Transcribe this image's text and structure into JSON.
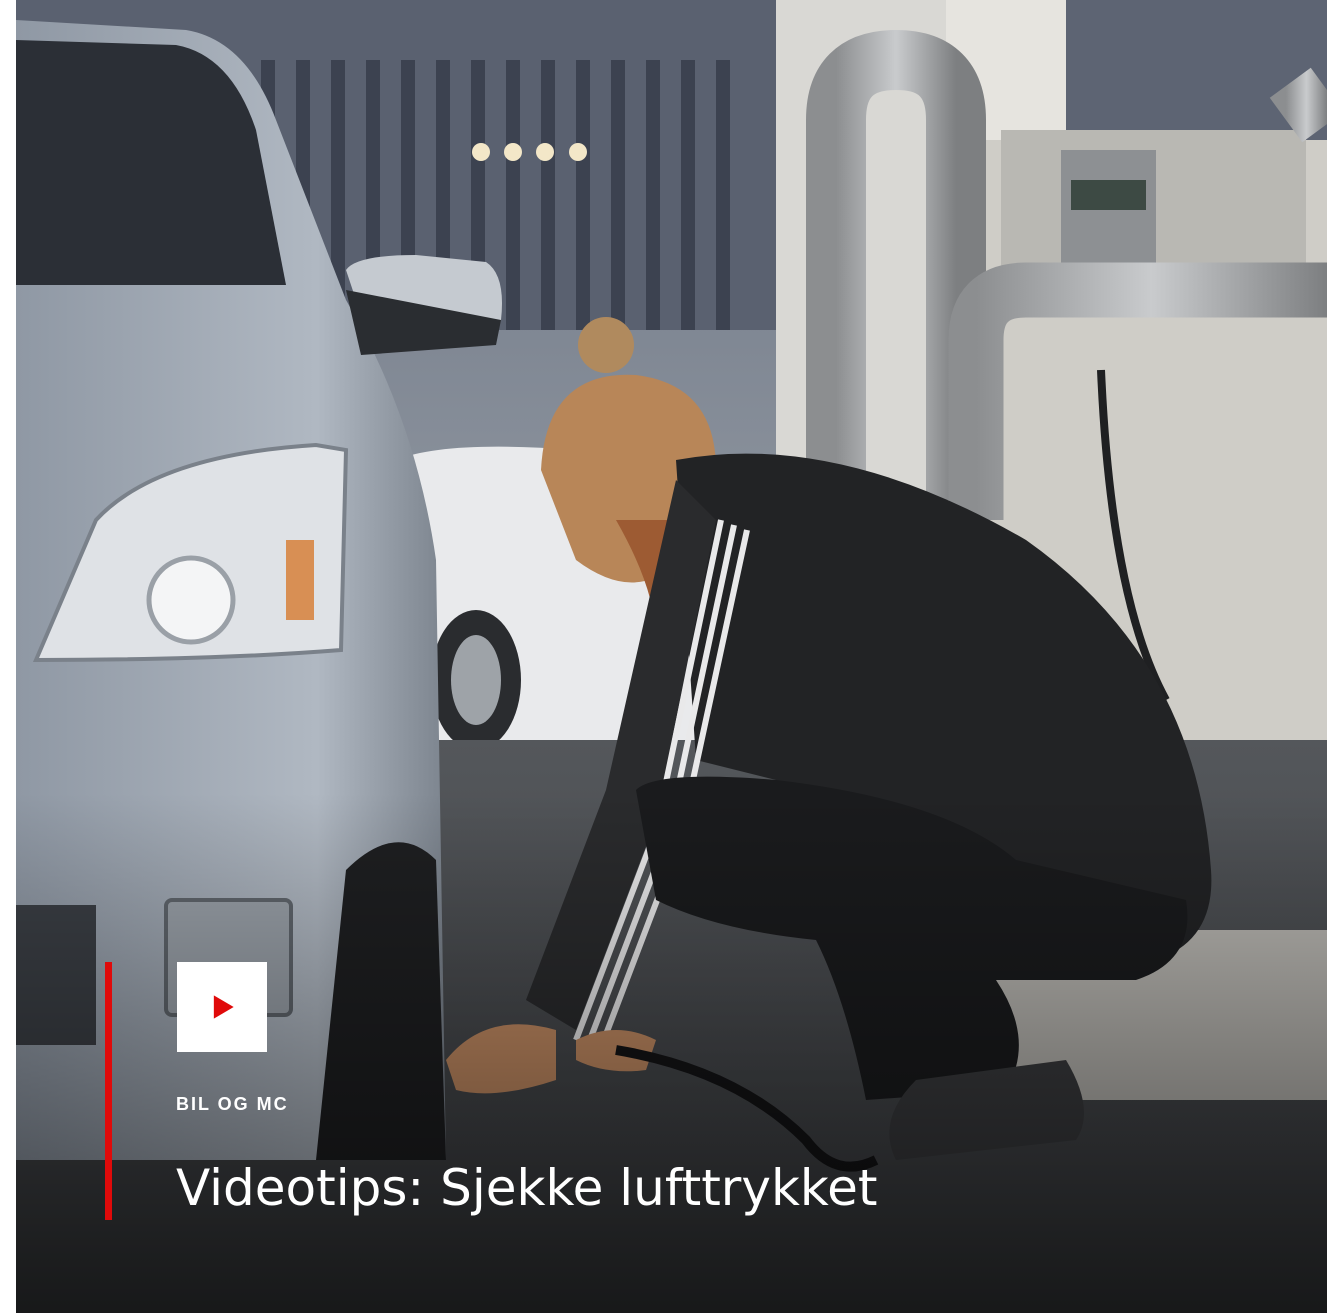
{
  "article": {
    "category": "BIL OG MC",
    "headline": "Videotips: Sjekke lufttrykket"
  },
  "media": {
    "play_icon": "play-icon",
    "photo": "person-checking-tire-pressure-photo"
  },
  "colors": {
    "accent": "#e00a0a",
    "play_button_bg": "#ffffff",
    "text": "#ffffff"
  }
}
